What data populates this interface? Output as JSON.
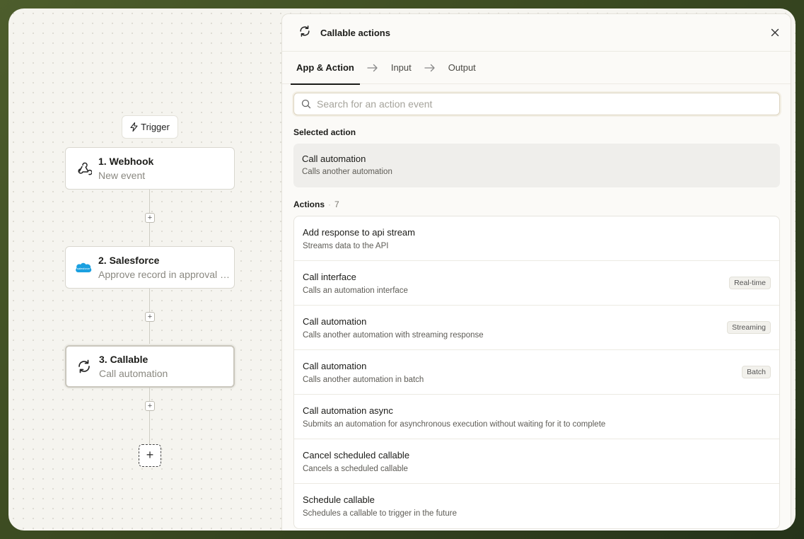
{
  "canvas": {
    "trigger_label": "Trigger",
    "nodes": [
      {
        "title": "1. Webhook",
        "subtitle": "New event",
        "icon": "webhook-icon"
      },
      {
        "title": "2. Salesforce",
        "subtitle": "Approve record in approval process",
        "icon": "salesforce-icon"
      },
      {
        "title": "3. Callable",
        "subtitle": "Call automation",
        "icon": "refresh-icon"
      }
    ],
    "add_step_symbol": "+",
    "insert_symbol": "+"
  },
  "panel": {
    "title": "Callable actions",
    "tabs": [
      "App & Action",
      "Input",
      "Output"
    ],
    "search": {
      "placeholder": "Search for an action event",
      "value": ""
    },
    "selected_label": "Selected action",
    "selected": {
      "title": "Call automation",
      "subtitle": "Calls another automation"
    },
    "actions_label": "Actions",
    "actions_separator": "·",
    "actions_count": "7",
    "actions": [
      {
        "title": "Add response to api stream",
        "subtitle": "Streams data to the API",
        "badge": ""
      },
      {
        "title": "Call interface",
        "subtitle": "Calls an automation interface",
        "badge": "Real-time"
      },
      {
        "title": "Call automation",
        "subtitle": "Calls another automation with streaming response",
        "badge": "Streaming"
      },
      {
        "title": "Call automation",
        "subtitle": "Calls another automation in batch",
        "badge": "Batch"
      },
      {
        "title": "Call automation async",
        "subtitle": "Submits an automation for asynchronous execution without waiting for it to complete",
        "badge": ""
      },
      {
        "title": "Cancel scheduled callable",
        "subtitle": "Cancels a scheduled callable",
        "badge": ""
      },
      {
        "title": "Schedule callable",
        "subtitle": "Schedules a callable to trigger in the future",
        "badge": ""
      }
    ]
  },
  "colors": {
    "accent": "#1b1b18",
    "background": "#4d5d2c",
    "salesforce": "#1ba0e0"
  }
}
